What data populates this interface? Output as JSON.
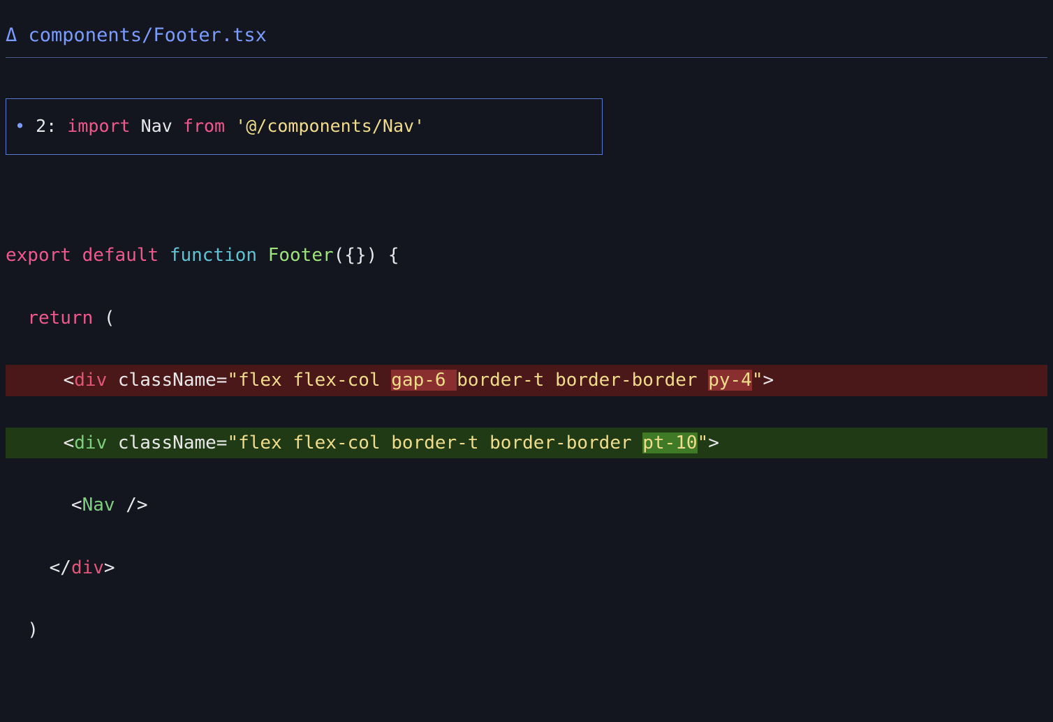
{
  "file_header": {
    "delta_symbol": "Δ",
    "path": "components/Footer.tsx"
  },
  "hunk": {
    "bullet": "•",
    "line_number": "2:",
    "t_import": "import",
    "t_nav": "Nav",
    "t_from": "from",
    "t_modpath": "'@/components/Nav'"
  },
  "code": {
    "l1": {
      "export": "export",
      "default": "default",
      "function": "function",
      "name": "Footer",
      "params": "({})",
      "brace_open": " {"
    },
    "l2": {
      "indent": "  ",
      "return": "return",
      "paren": " ("
    },
    "del": {
      "indent": "    ",
      "open": "<",
      "tag": "div",
      "sp": " ",
      "attr": "className",
      "eq": "=",
      "q1": "\"",
      "p1": "flex flex-col ",
      "h1": "gap-6 ",
      "p2": "border-t border-border ",
      "h2": "py-4",
      "q2": "\"",
      "close": ">"
    },
    "add": {
      "indent": "    ",
      "open": "<",
      "tag": "div",
      "sp": " ",
      "attr": "className",
      "eq": "=",
      "q1": "\"",
      "p1": "flex flex-col border-t border-border ",
      "h1": "pt-10",
      "q2": "\"",
      "close": ">"
    },
    "nav": {
      "indent": "      ",
      "open": "<",
      "name": "Nav",
      "selfclose": " />"
    },
    "closediv": {
      "indent": "    ",
      "open": "</",
      "name": "div",
      "close": ">"
    },
    "paren_close": {
      "indent": "  ",
      "paren": ")"
    }
  }
}
